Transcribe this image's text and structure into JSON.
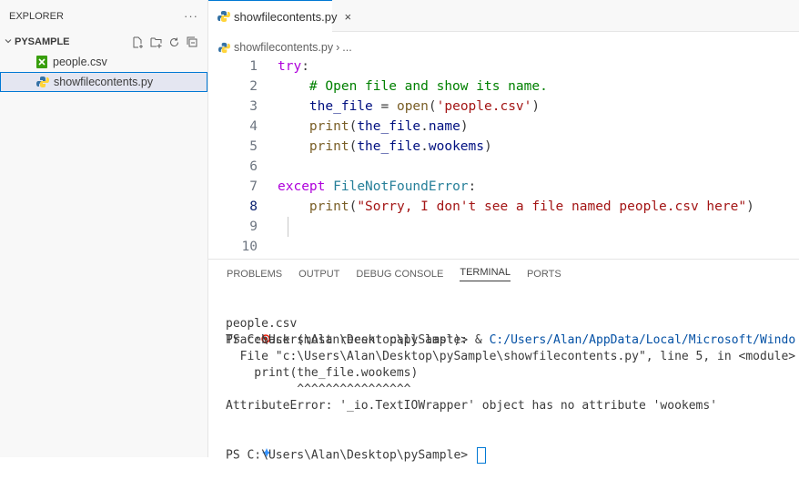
{
  "explorer": {
    "title": "EXPLORER",
    "more": "···",
    "folder": "PYSAMPLE",
    "files": [
      {
        "name": "people.csv",
        "icon": "csv-file-icon"
      },
      {
        "name": "showfilecontents.py",
        "icon": "python-file-icon"
      }
    ]
  },
  "tab": {
    "label": "showfilecontents.py",
    "close": "×"
  },
  "breadcrumb": {
    "file": "showfilecontents.py",
    "sep": "›",
    "rest": "..."
  },
  "code_lines": [
    {
      "n": "1",
      "segments": [
        {
          "t": "try",
          "c": "kw"
        },
        {
          "t": ":",
          "c": ""
        }
      ]
    },
    {
      "n": "2",
      "segments": [
        {
          "t": "    ",
          "c": ""
        },
        {
          "t": "# Open file and show its name.",
          "c": "cm"
        }
      ]
    },
    {
      "n": "3",
      "segments": [
        {
          "t": "    ",
          "c": ""
        },
        {
          "t": "the_file",
          "c": "var"
        },
        {
          "t": " = ",
          "c": ""
        },
        {
          "t": "open",
          "c": "fn"
        },
        {
          "t": "(",
          "c": ""
        },
        {
          "t": "'people.csv'",
          "c": "str"
        },
        {
          "t": ")",
          "c": ""
        }
      ]
    },
    {
      "n": "4",
      "segments": [
        {
          "t": "    ",
          "c": ""
        },
        {
          "t": "print",
          "c": "fn"
        },
        {
          "t": "(",
          "c": ""
        },
        {
          "t": "the_file",
          "c": "var"
        },
        {
          "t": ".",
          "c": ""
        },
        {
          "t": "name",
          "c": "var"
        },
        {
          "t": ")",
          "c": ""
        }
      ]
    },
    {
      "n": "5",
      "segments": [
        {
          "t": "    ",
          "c": ""
        },
        {
          "t": "print",
          "c": "fn"
        },
        {
          "t": "(",
          "c": ""
        },
        {
          "t": "the_file",
          "c": "var"
        },
        {
          "t": ".",
          "c": ""
        },
        {
          "t": "wookems",
          "c": "var"
        },
        {
          "t": ")",
          "c": ""
        }
      ]
    },
    {
      "n": "6",
      "segments": []
    },
    {
      "n": "7",
      "segments": [
        {
          "t": "except",
          "c": "kw"
        },
        {
          "t": " ",
          "c": ""
        },
        {
          "t": "FileNotFoundError",
          "c": "cls"
        },
        {
          "t": ":",
          "c": ""
        }
      ]
    },
    {
      "n": "8",
      "segments": [
        {
          "t": "    ",
          "c": ""
        },
        {
          "t": "print",
          "c": "fn"
        },
        {
          "t": "(",
          "c": ""
        },
        {
          "t": "\"Sorry, I don't see a file named people.csv here\"",
          "c": "str"
        },
        {
          "t": ")",
          "c": ""
        }
      ]
    },
    {
      "n": "9",
      "segments": []
    },
    {
      "n": "10",
      "segments": []
    }
  ],
  "active_line": "8",
  "panel_tabs": [
    "PROBLEMS",
    "OUTPUT",
    "DEBUG CONSOLE",
    "TERMINAL",
    "PORTS"
  ],
  "active_panel_tab": "TERMINAL",
  "terminal": {
    "prompt_line": {
      "prefix": "PS C:\\Users\\Alan\\Desktop\\pySample> & ",
      "path": "C:/Users/Alan/AppData/Local/Microsoft/Windo"
    },
    "lines": [
      "people.csv",
      "Traceback (most recent call last):",
      "  File \"c:\\Users\\Alan\\Desktop\\pySample\\showfilecontents.py\", line 5, in <module>",
      "    print(the_file.wookems)",
      "          ^^^^^^^^^^^^^^^^",
      "AttributeError: '_io.TextIOWrapper' object has no attribute 'wookems'"
    ],
    "last_prompt": "PS C:\\Users\\Alan\\Desktop\\pySample> "
  },
  "colors": {
    "accent": "#0078d4",
    "error": "#e51400",
    "python_blue": "#3572a5",
    "python_yellow": "#ffd43b",
    "csv_green": "#389e0d"
  }
}
